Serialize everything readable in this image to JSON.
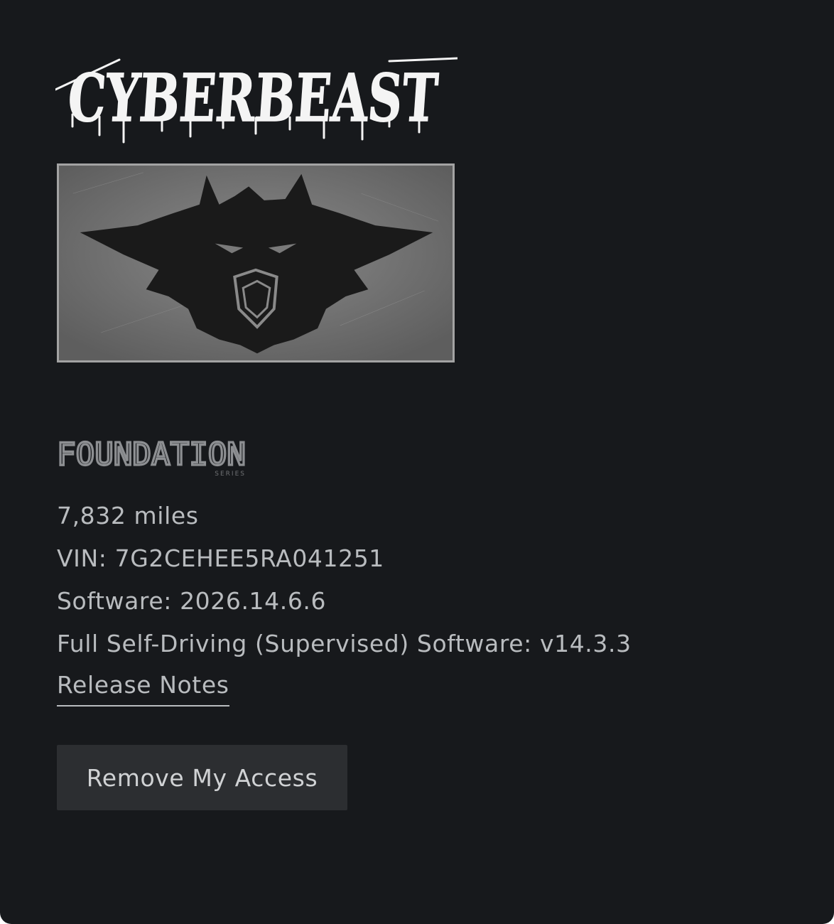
{
  "vehicle": {
    "model_logo_text": "CYBERBEAST",
    "badge_image": "cyberbeast-wolf-badge",
    "series_logo": {
      "main": "FOUNDATION",
      "sub": "SERIES"
    },
    "mileage": "7,832 miles",
    "vin": "VIN: 7G2CEHEE5RA041251",
    "software": "Software: 2026.14.6.6",
    "fsd": "Full Self-Driving (Supervised) Software: v14.3.3"
  },
  "links": {
    "release_notes": "Release Notes"
  },
  "actions": {
    "remove_access": "Remove My Access"
  },
  "colors": {
    "background": "#17191c",
    "text": "#b9bcbf",
    "button_bg": "#2c2e31"
  }
}
